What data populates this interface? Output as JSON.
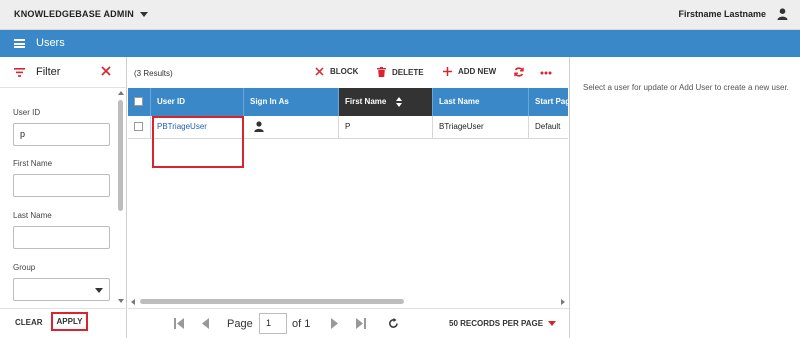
{
  "app": {
    "title": "KNOWLEDGEBASE ADMIN",
    "user_name": "Firstname Lastname"
  },
  "page": {
    "title": "Users"
  },
  "filter": {
    "title": "Filter",
    "fields": [
      {
        "label": "User ID",
        "value": "p"
      },
      {
        "label": "First Name",
        "value": ""
      },
      {
        "label": "Last Name",
        "value": ""
      },
      {
        "label": "Group",
        "value": ""
      }
    ],
    "clear_label": "CLEAR",
    "apply_label": "APPLY"
  },
  "toolbar": {
    "results": "(3 Results)",
    "block_label": "BLOCK",
    "delete_label": "DELETE",
    "add_label": "ADD NEW"
  },
  "grid": {
    "columns": [
      "User ID",
      "Sign In As",
      "First Name",
      "Last Name",
      "Start Pag"
    ],
    "rows": [
      {
        "user_id": "PBTriageUser",
        "first_name": "P",
        "last_name": "BTriageUser",
        "start_page": "Default"
      }
    ]
  },
  "pager": {
    "page_label": "Page",
    "page_value": "1",
    "of_label": "of 1",
    "per_page": "50 RECORDS PER PAGE"
  },
  "detail": {
    "message": "Select a user for update or Add User to create a new user."
  },
  "colors": {
    "primary": "#3a88c8",
    "accent_red": "#d9232d",
    "link": "#1f62b4",
    "sorted_header": "#333333"
  }
}
